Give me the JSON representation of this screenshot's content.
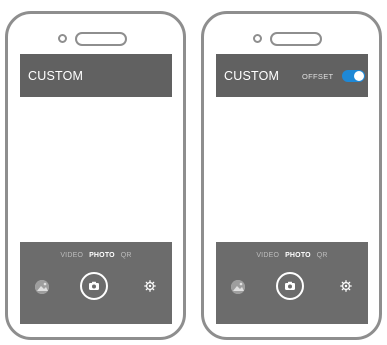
{
  "phones": [
    {
      "title": "CUSTOM",
      "modes": [
        "VIDEO",
        "PHOTO",
        "QR"
      ],
      "active_mode": "PHOTO"
    },
    {
      "title": "CUSTOM",
      "offset_label": "OFFSET",
      "offset_enabled": true,
      "modes": [
        "VIDEO",
        "PHOTO",
        "QR"
      ],
      "active_mode": "PHOTO"
    }
  ],
  "colors": {
    "bar": "#616161",
    "bottom_bar": "#6c6c6c",
    "toggle_on": "#1e88d6",
    "frame": "#8e8e8e"
  },
  "icons": {
    "gallery": "gallery-thumbnail-icon",
    "shutter": "camera-icon",
    "settings": "gear-icon"
  }
}
